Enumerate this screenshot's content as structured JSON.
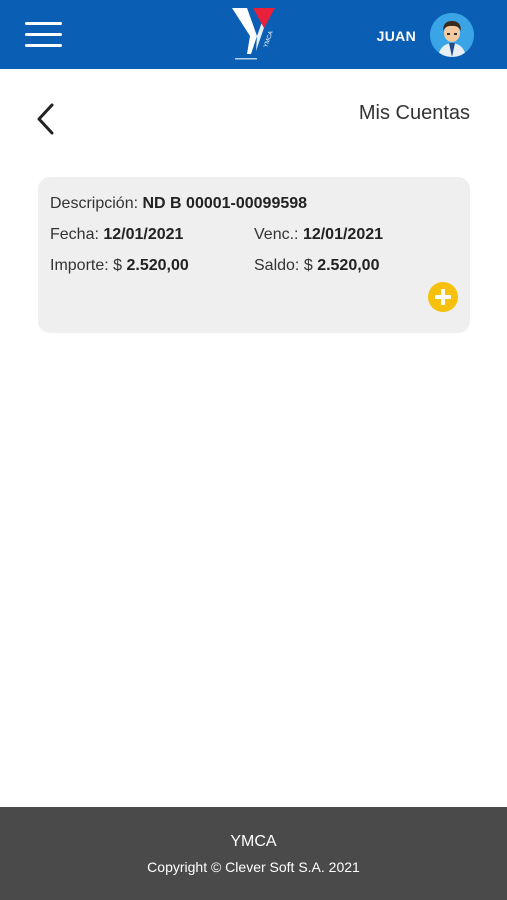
{
  "header": {
    "logo_text": "YMCA",
    "user_name": "JUAN"
  },
  "page": {
    "title": "Mis Cuentas"
  },
  "account": {
    "descripcion_label": "Descripción:",
    "descripcion_value": "ND B 00001-00099598",
    "fecha_label": "Fecha:",
    "fecha_value": "12/01/2021",
    "venc_label": "Venc.:",
    "venc_value": "12/01/2021",
    "importe_label": "Importe:",
    "importe_currency": "$",
    "importe_value": "2.520,00",
    "saldo_label": "Saldo:",
    "saldo_currency": "$",
    "saldo_value": "2.520,00"
  },
  "footer": {
    "brand": "YMCA",
    "copyright": "Copyright © Clever Soft S.A. 2021"
  },
  "colors": {
    "header_bg": "#0a5fb4",
    "footer_bg": "#4a4a4a",
    "card_bg": "#efefef",
    "accent_yellow": "#f5c10d",
    "logo_red": "#e8203a"
  },
  "icons": {
    "menu": "hamburger-menu-icon",
    "back": "chevron-left-icon",
    "add": "plus-circle-icon",
    "avatar": "user-avatar"
  }
}
